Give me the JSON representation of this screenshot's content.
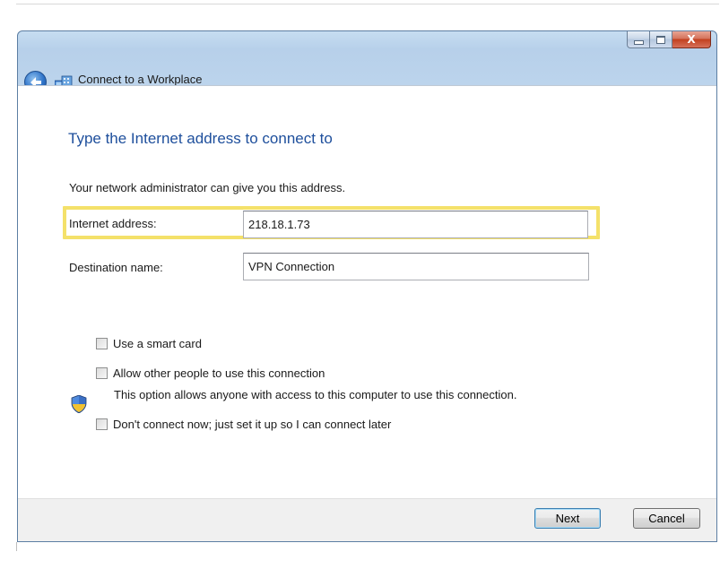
{
  "window": {
    "title": "Connect to a Workplace",
    "caption": {
      "close_label": "X"
    }
  },
  "page": {
    "heading": "Type the Internet address to connect to",
    "intro": "Your network administrator can give you this address."
  },
  "fields": {
    "internet_address": {
      "label": "Internet address:",
      "value": "218.18.1.73"
    },
    "destination_name": {
      "label": "Destination name:",
      "value": "VPN Connection"
    }
  },
  "options": {
    "smart_card": {
      "label": "Use a smart card",
      "checked": false
    },
    "allow_others": {
      "label": "Allow other people to use this connection",
      "description": "This option allows anyone with access to this computer to use this connection.",
      "checked": false
    },
    "connect_later": {
      "label": "Don't connect now; just set it up so I can connect later",
      "checked": false
    }
  },
  "buttons": {
    "next": "Next",
    "cancel": "Cancel"
  },
  "colors": {
    "heading": "#1e4f9c",
    "highlight": "#f4e16a"
  }
}
